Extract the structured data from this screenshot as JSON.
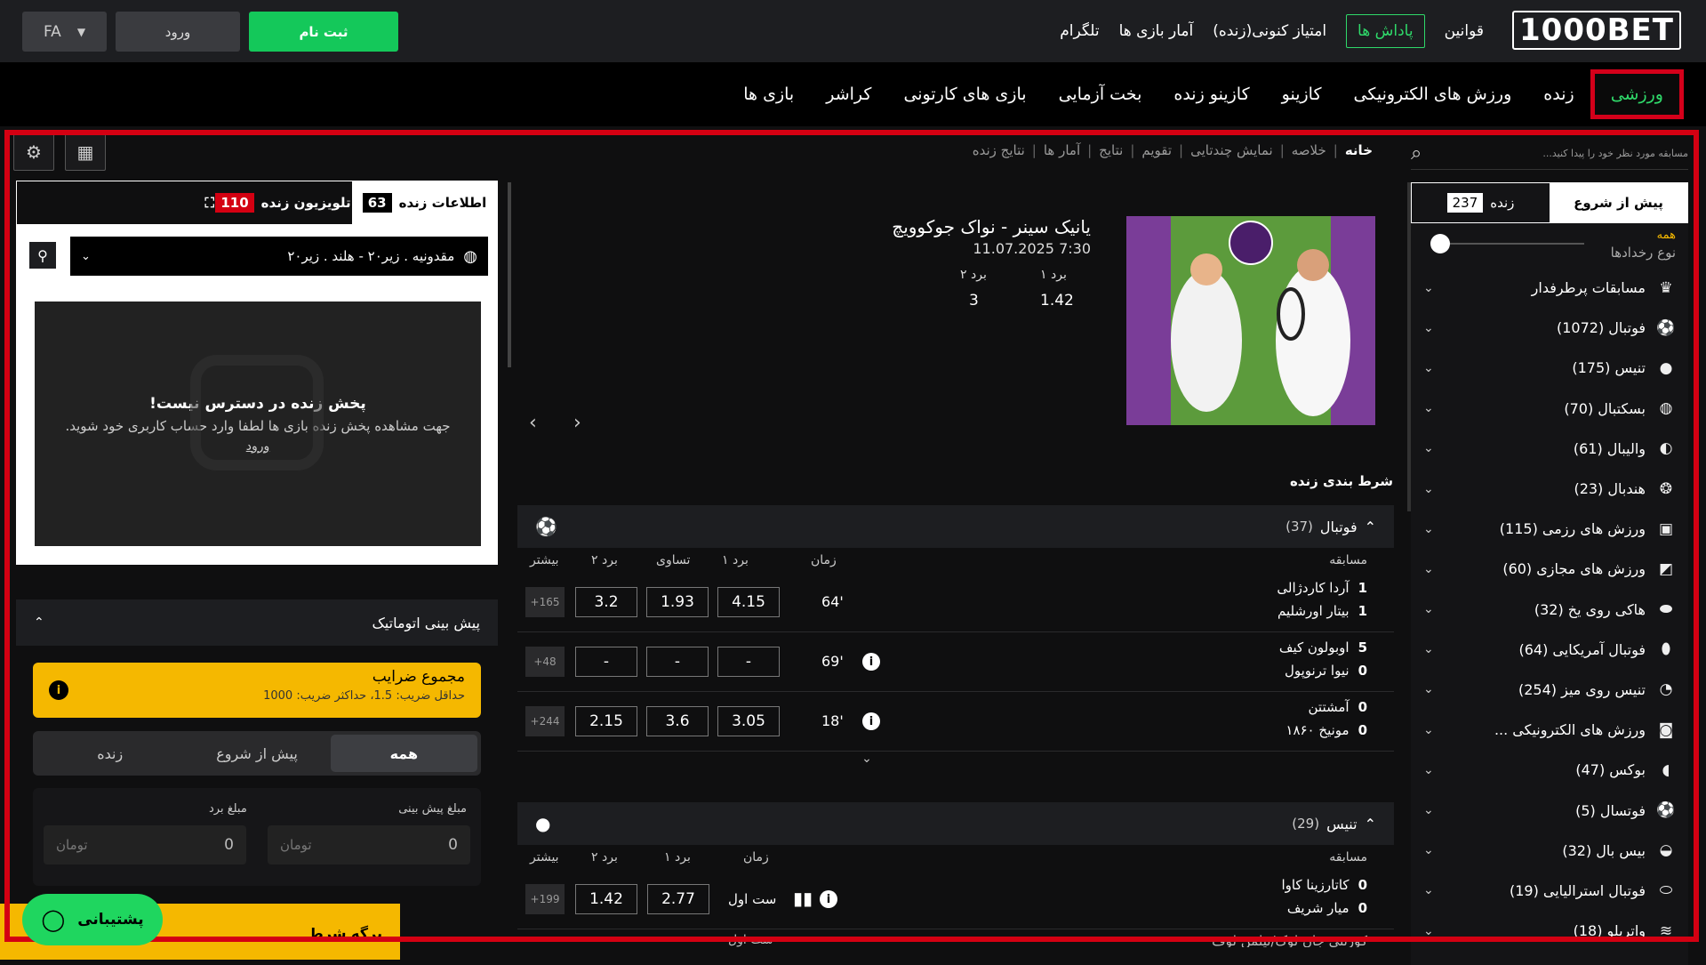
{
  "header": {
    "logo": "1000BET",
    "links": [
      "قوانین",
      "پاداش ها",
      "امتیاز کنونی(زنده)",
      "آمار بازی ها",
      "تلگرام"
    ],
    "register": "ثبت نام",
    "login": "ورود",
    "lang": "FA"
  },
  "nav": [
    "ورزشی",
    "زنده",
    "ورزش های الکترونیکی",
    "کازینو",
    "کازینو زنده",
    "بخت آزمایی",
    "بازی های کارتونی",
    "کراشر",
    "بازی ها"
  ],
  "search": {
    "placeholder": "مسابقه مورد نظر خود را پیدا کنید..."
  },
  "breadcrumbs": [
    "خانه",
    "خلاصه",
    "نمایش چندتایی",
    "تقویم",
    "نتایج",
    "آمار ها",
    "نتایج زنده"
  ],
  "sidebar": {
    "tabs": [
      {
        "label": "پیش از شروع"
      },
      {
        "label": "زنده",
        "count": "237"
      }
    ],
    "event_type": {
      "value": "همه",
      "label": "نوع رخدادها"
    },
    "items": [
      {
        "label": "مسابقات پرطرفدار",
        "icon": "trophy-icon",
        "glyph": "♛"
      },
      {
        "label": "فوتبال (1072)",
        "icon": "football-icon",
        "glyph": "⚽"
      },
      {
        "label": "تنیس (175)",
        "icon": "tennis-icon",
        "glyph": "●"
      },
      {
        "label": "بسکتبال (70)",
        "icon": "basketball-icon",
        "glyph": "◍"
      },
      {
        "label": "والیبال (61)",
        "icon": "volleyball-icon",
        "glyph": "◐"
      },
      {
        "label": "هندبال (23)",
        "icon": "handball-icon",
        "glyph": "❂"
      },
      {
        "label": "ورزش های رزمی (115)",
        "icon": "martial-arts-icon",
        "glyph": "▣"
      },
      {
        "label": "ورزش های مجازی (60)",
        "icon": "virtual-sports-icon",
        "glyph": "◩"
      },
      {
        "label": "هاکی روی یخ (32)",
        "icon": "ice-hockey-icon",
        "glyph": "⬬"
      },
      {
        "label": "فوتبال آمریکایی (64)",
        "icon": "american-football-icon",
        "glyph": "⬮"
      },
      {
        "label": "تنیس روی میز (254)",
        "icon": "table-tennis-icon",
        "glyph": "◔"
      },
      {
        "label": "ورزش های الکترونیکی ...",
        "icon": "esports-icon",
        "glyph": "◙"
      },
      {
        "label": "بوکس (47)",
        "icon": "boxing-icon",
        "glyph": "◖"
      },
      {
        "label": "فوتسال (5)",
        "icon": "futsal-icon",
        "glyph": "⚽"
      },
      {
        "label": "بیس بال (32)",
        "icon": "baseball-icon",
        "glyph": "◒"
      },
      {
        "label": "فوتبال استرالیایی (19)",
        "icon": "aussie-rules-icon",
        "glyph": "⬭"
      },
      {
        "label": "واترپلو (18)",
        "icon": "water-polo-icon",
        "glyph": "≋"
      }
    ]
  },
  "banner": {
    "title": "یانیک سینر - نواک جوکوویچ",
    "date": "11.07.2025 7:30",
    "odds": [
      {
        "label": "برد ۱",
        "value": "1.42"
      },
      {
        "label": "برد ۲",
        "value": "3"
      }
    ]
  },
  "live_betting_title": "شرط بندی زنده",
  "columns": {
    "match": "مسابقه",
    "time": "زمان",
    "w1": "برد ۱",
    "draw": "تساوی",
    "w2": "برد ۲",
    "more": "بیشتر"
  },
  "football": {
    "name": "فوتبال",
    "count": "(37)",
    "rows": [
      {
        "t1": "آردا کاردژالی",
        "s1": "1",
        "t2": "بیتار اورشلیم",
        "s2": "1",
        "time": "64'",
        "w1": "4.15",
        "x": "1.93",
        "w2": "3.2",
        "more": "+165",
        "info": false
      },
      {
        "t1": "اوبولون کیف",
        "s1": "5",
        "t2": "نیوا ترنوپول",
        "s2": "0",
        "time": "69'",
        "w1": "-",
        "x": "-",
        "w2": "-",
        "more": "+48",
        "info": true
      },
      {
        "t1": "آمشتتن",
        "s1": "0",
        "t2": "مونیخ ۱۸۶۰",
        "s2": "0",
        "time": "18'",
        "w1": "3.05",
        "x": "3.6",
        "w2": "2.15",
        "more": "+244",
        "info": true
      }
    ]
  },
  "tennis": {
    "name": "تنیس",
    "count": "(29)",
    "rows": [
      {
        "t1": "کاتارزینا کاوا",
        "s1": "0",
        "t2": "میار شریف",
        "s2": "0",
        "time": "ست اول",
        "w1": "2.77",
        "w2": "1.42",
        "more": "+199"
      }
    ],
    "partial_team": "کورنتی جان لوک/نیلمن لوف",
    "partial_time": "ست اول"
  },
  "live_panel": {
    "tab_info": "اطلاعات زنده",
    "tab_info_count": "63",
    "tab_tv": "تلویزیون زنده",
    "tab_tv_count": "110",
    "match_select": "مقدونیه . زیر۲۰ - هلند . زیر۲۰",
    "unavailable_title": "پخش زنده در دسترس نیست!",
    "unavailable_text": "جهت مشاهده پخش زنده بازی ها لطفا وارد حساب کاربری خود شوید.",
    "login_link": "ورود"
  },
  "auto_bet": {
    "title": "پیش بینی اتوماتیک",
    "odds_title": "مجموع ضرایب",
    "odds_text": "حداقل ضریب: 1.5، حداکثر ضریب: 1000",
    "seg": [
      "همه",
      "پیش از شروع",
      "زنده"
    ],
    "stake_label": "مبلغ پیش بینی",
    "win_label": "مبلغ برد",
    "stake_value": "0",
    "win_value": "0",
    "currency": "تومان"
  },
  "betslip": "برگه شرط",
  "support": "پشتیبانی",
  "colors": {
    "accent": "#14c85a",
    "highlight": "#d40012",
    "yellow": "#f5b800"
  }
}
